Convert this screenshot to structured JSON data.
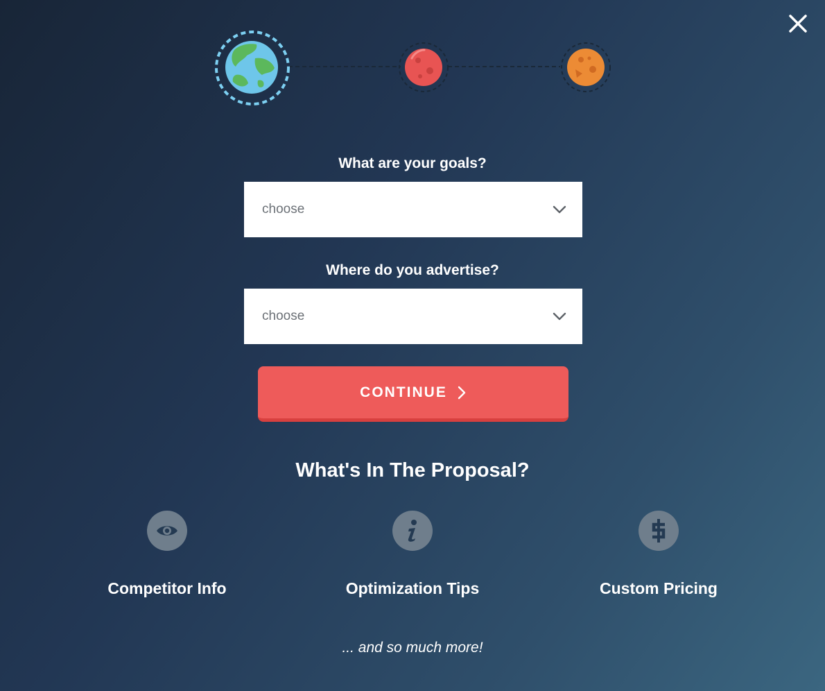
{
  "stepper": {
    "steps": [
      {
        "name": "earth",
        "state": "active",
        "color": "#6ec6ea"
      },
      {
        "name": "red-planet",
        "state": "upcoming",
        "color": "#e85453"
      },
      {
        "name": "orange-planet",
        "state": "upcoming",
        "color": "#ec8b35"
      }
    ]
  },
  "form": {
    "goals": {
      "label": "What are your goals?",
      "value": "choose"
    },
    "advertise": {
      "label": "Where do you advertise?",
      "value": "choose"
    },
    "continue_label": "CONTINUE"
  },
  "proposal": {
    "title": "What's In The Proposal?",
    "features": [
      {
        "label": "Competitor Info",
        "icon": "eye-icon"
      },
      {
        "label": "Optimization Tips",
        "icon": "info-icon"
      },
      {
        "label": "Custom Pricing",
        "icon": "dollar-icon"
      }
    ],
    "more": "... and so much more!"
  },
  "colors": {
    "accent": "#ee5b5a",
    "icon_bg": "#6f7e8c"
  }
}
